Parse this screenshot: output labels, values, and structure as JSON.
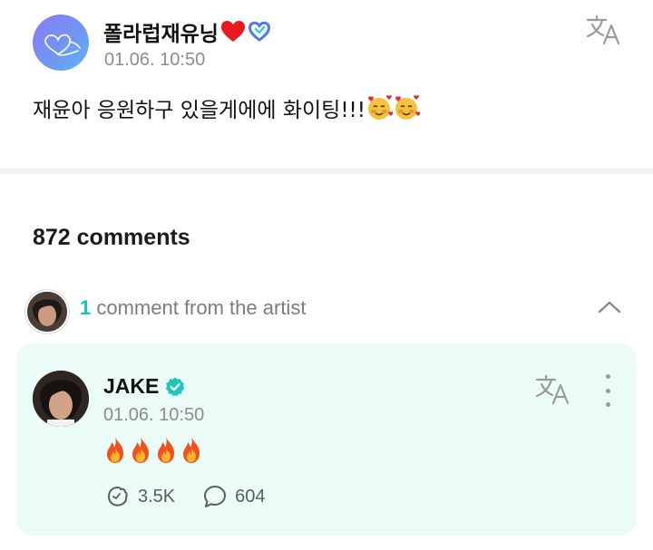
{
  "post": {
    "author_name": "폴라럽재유닝",
    "timestamp": "01.06. 10:50",
    "text": "재윤아 응원하구 있을게에에 화이팅!!!",
    "name_icons": [
      "red-heart-icon",
      "blue-heart-icon"
    ],
    "text_emojis": [
      "smiling-face-with-hearts-icon",
      "smiling-face-with-hearts-icon"
    ]
  },
  "comments": {
    "count_label": "872 comments",
    "artist_section": {
      "count": "1",
      "label": " comment from the artist"
    }
  },
  "artist_comment": {
    "author_name": "JAKE",
    "verified": true,
    "timestamp": "01.06. 10:50",
    "content_emojis": [
      "fire-icon",
      "fire-icon",
      "fire-icon",
      "fire-icon"
    ],
    "likes": "3.5K",
    "replies": "604"
  },
  "colors": {
    "accent": "#0bc6b3",
    "card_background": "#ebfbf7",
    "muted_text": "#8c8c8c",
    "verified_badge": "#1fc6b6"
  }
}
